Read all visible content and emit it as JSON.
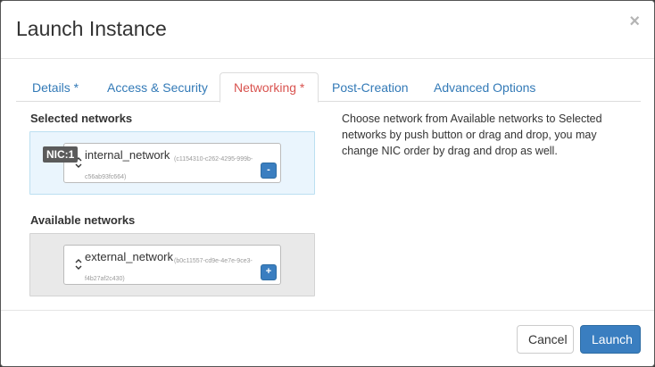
{
  "dialog": {
    "title": "Launch Instance",
    "close_glyph": "×"
  },
  "tabs": [
    {
      "label": "Details *",
      "active": false
    },
    {
      "label": "Access & Security",
      "active": false
    },
    {
      "label": "Networking *",
      "active": true
    },
    {
      "label": "Post-Creation",
      "active": false
    },
    {
      "label": "Advanced Options",
      "active": false
    }
  ],
  "selected_networks": {
    "label": "Selected networks",
    "items": [
      {
        "nic": "NIC:1",
        "name": "internal_network",
        "id": "(c1154310-c262-4295-999b-c56ab93fc664)",
        "button": "-"
      }
    ]
  },
  "available_networks": {
    "label": "Available networks",
    "items": [
      {
        "name": "external_network",
        "id": "(b0c11557-cd9e-4e7e-9ce3-f4b27af2c430)",
        "button": "+"
      }
    ]
  },
  "help_text": "Choose network from Available networks to Selected networks by push button or drag and drop, you may change NIC order by drag and drop as well.",
  "footer": {
    "cancel_label": "Cancel",
    "launch_label": "Launch"
  },
  "colors": {
    "accent": "#3a7ec0",
    "active_tab": "#d9534f",
    "link": "#337ab7",
    "selected_zone_bg": "#eaf5fd",
    "available_zone_bg": "#e9e9e9"
  }
}
